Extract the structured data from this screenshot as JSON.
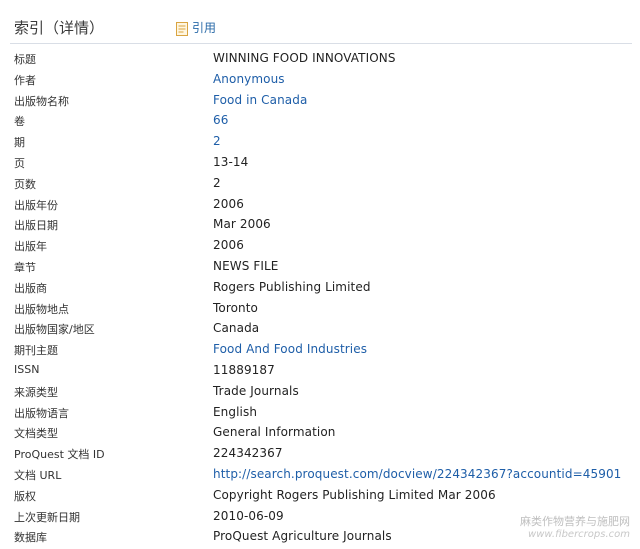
{
  "header": {
    "title": "索引（详情）",
    "cite_label": "引用"
  },
  "colors": {
    "link": "#1e5ea8",
    "text": "#222222",
    "rule": "#d9dee6"
  },
  "fields": [
    {
      "label": "标题",
      "value": "WINNING FOOD INNOVATIONS",
      "link": false
    },
    {
      "label": "作者",
      "value": "Anonymous",
      "link": true
    },
    {
      "label": "出版物名称",
      "value": "Food in Canada",
      "link": true
    },
    {
      "label": "卷",
      "value": "66",
      "link": true
    },
    {
      "label": "期",
      "value": "2",
      "link": true
    },
    {
      "label": "页",
      "value": "13-14",
      "link": false
    },
    {
      "label": "页数",
      "value": "2",
      "link": false
    },
    {
      "label": "出版年份",
      "value": "2006",
      "link": false
    },
    {
      "label": "出版日期",
      "value": "Mar 2006",
      "link": false
    },
    {
      "label": "出版年",
      "value": "2006",
      "link": false
    },
    {
      "label": "章节",
      "value": "NEWS FILE",
      "link": false
    },
    {
      "label": "出版商",
      "value": "Rogers Publishing Limited",
      "link": false
    },
    {
      "label": "出版物地点",
      "value": "Toronto",
      "link": false
    },
    {
      "label": "出版物国家/地区",
      "value": "Canada",
      "link": false
    },
    {
      "label": "期刊主题",
      "value": "Food And Food Industries",
      "link": true
    },
    {
      "label": "ISSN",
      "value": "11889187",
      "link": false
    },
    {
      "label": "来源类型",
      "value": "Trade Journals",
      "link": false
    },
    {
      "label": "出版物语言",
      "value": "English",
      "link": false
    },
    {
      "label": "文档类型",
      "value": "General Information",
      "link": false
    },
    {
      "label": "ProQuest 文档 ID",
      "value": "224342367",
      "link": false
    },
    {
      "label": "文档 URL",
      "value": "http://search.proquest.com/docview/224342367?accountid=45901",
      "link": true
    },
    {
      "label": "版权",
      "value": "Copyright Rogers Publishing Limited Mar 2006",
      "link": false
    },
    {
      "label": "上次更新日期",
      "value": "2010-06-09",
      "link": false
    },
    {
      "label": "数据库",
      "value": "ProQuest Agriculture Journals",
      "link": false
    }
  ],
  "watermark": {
    "text": "麻类作物营养与施肥网",
    "url": "www.fibercrops.com"
  }
}
